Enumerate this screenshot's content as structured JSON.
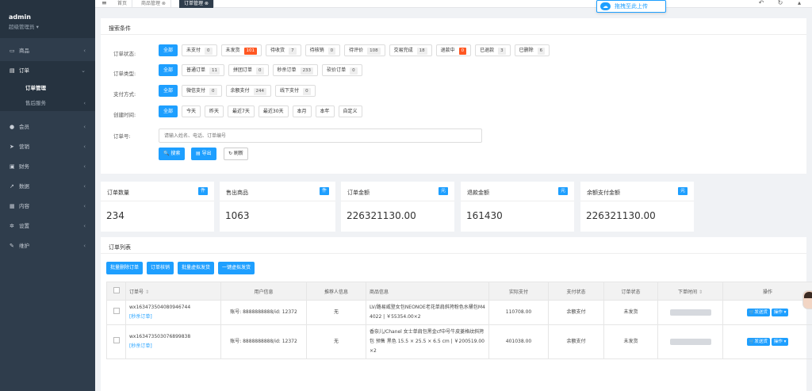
{
  "sidebar": {
    "user": "admin",
    "role": "超级管理员",
    "items": [
      {
        "label": "商品",
        "icon": "monitor-icon"
      },
      {
        "label": "订单",
        "icon": "document-icon"
      },
      {
        "label": "会员",
        "icon": "user-icon"
      },
      {
        "label": "营销",
        "icon": "send-icon"
      },
      {
        "label": "财务",
        "icon": "wallet-icon"
      },
      {
        "label": "数据",
        "icon": "chart-icon"
      },
      {
        "label": "内容",
        "icon": "content-icon"
      },
      {
        "label": "设置",
        "icon": "gear-icon"
      },
      {
        "label": "维护",
        "icon": "wrench-icon"
      }
    ],
    "sub": [
      {
        "label": "订单管理"
      },
      {
        "label": "售后服务"
      }
    ]
  },
  "topbar": {
    "tabs": [
      {
        "label": "首页"
      },
      {
        "label": "商品管理 ⊗"
      },
      {
        "label": "订单管理 ⊗"
      }
    ],
    "upload_label": "拖拽至此上传",
    "upload_glyph": "☁"
  },
  "search": {
    "title": "搜索条件",
    "status_label": "订单状态:",
    "status_opts": [
      {
        "label": "全部",
        "count": ""
      },
      {
        "label": "未支付",
        "count": "0"
      },
      {
        "label": "未发货",
        "count": "101"
      },
      {
        "label": "待收货",
        "count": "7"
      },
      {
        "label": "待核销",
        "count": "0"
      },
      {
        "label": "待评价",
        "count": "108"
      },
      {
        "label": "交易完成",
        "count": "18"
      },
      {
        "label": "退款中",
        "count": "0"
      },
      {
        "label": "已退款",
        "count": "3"
      },
      {
        "label": "已删除",
        "count": "6"
      }
    ],
    "type_label": "订单类型:",
    "type_opts": [
      {
        "label": "全部",
        "count": ""
      },
      {
        "label": "普通订单",
        "count": "11"
      },
      {
        "label": "拼团订单",
        "count": "0"
      },
      {
        "label": "秒杀订单",
        "count": "233"
      },
      {
        "label": "砍价订单",
        "count": "0"
      }
    ],
    "pay_label": "支付方式:",
    "pay_opts": [
      {
        "label": "全部",
        "count": ""
      },
      {
        "label": "微信支付",
        "count": "0"
      },
      {
        "label": "余额支付",
        "count": "244"
      },
      {
        "label": "线下支付",
        "count": "0"
      }
    ],
    "time_label": "创建时间:",
    "time_opts": [
      {
        "label": "全部"
      },
      {
        "label": "今天"
      },
      {
        "label": "昨天"
      },
      {
        "label": "最近7天"
      },
      {
        "label": "最近30天"
      },
      {
        "label": "本月"
      },
      {
        "label": "本年"
      },
      {
        "label": "自定义"
      }
    ],
    "order_label": "订单号:",
    "placeholder": "请输入姓名、电话、订单编号",
    "btn_search": "🔍 搜索",
    "btn_export": "▤ 导出",
    "btn_refresh": "↻ 刷新"
  },
  "stats": [
    {
      "title": "订单数量",
      "badge": "件",
      "value": "234"
    },
    {
      "title": "售出商品",
      "badge": "件",
      "value": "1063"
    },
    {
      "title": "订单金额",
      "badge": "元",
      "value": "226321130.00"
    },
    {
      "title": "退款金额",
      "badge": "元",
      "value": "161430"
    },
    {
      "title": "余额支付金额",
      "badge": "元",
      "value": "226321130.00"
    }
  ],
  "list": {
    "title": "订单列表",
    "actions": [
      "批量删除订单",
      "订单核销",
      "批量虚拟发货",
      "一键虚拟发货"
    ],
    "headers": [
      "订单号",
      "用户信息",
      "推荐人信息",
      "商品信息",
      "实际支付",
      "支付状态",
      "订单状态",
      "下单时间",
      "操作"
    ],
    "sort_glyph": "⇕",
    "rows": [
      {
        "order_no": "wx163473504080946744",
        "tag": "[秒杀订单]",
        "user": "账号: 8888888888/id: 12372",
        "referrer": "无",
        "goods": "LV/路易威登女包NEONOE老花单肩斜挎粉色水桶包M44022 | ￥55354.00×2",
        "paid": "110708.00",
        "pay_status": "余额支付",
        "order_status": "未发货",
        "ship": "🛒发送货",
        "more": "操作 ▾"
      },
      {
        "order_no": "wx163473503076899838",
        "tag": "[秒杀订单]",
        "user": "账号: 8888888888/id: 12372",
        "referrer": "无",
        "goods": "香奈儿/Chanel 女士单肩包黑金cf中号牛皮菱格纹斜挎包 预售 黑色 15.5 × 25.5 × 6.5 cm | ￥200519.00×2",
        "paid": "401038.00",
        "pay_status": "余额支付",
        "order_status": "未发货",
        "ship": "🛒发送货",
        "more": "操作 ▾"
      }
    ]
  }
}
